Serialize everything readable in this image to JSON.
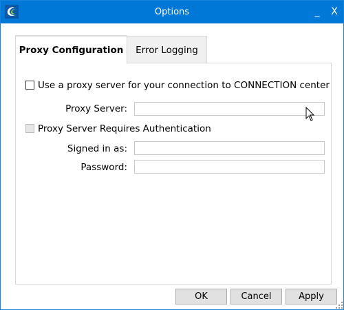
{
  "window": {
    "title": "Options",
    "minimize_glyph": "_",
    "close_glyph": "X"
  },
  "tabs": [
    {
      "label": "Proxy Configuration",
      "active": true
    },
    {
      "label": "Error Logging",
      "active": false
    }
  ],
  "proxy": {
    "use_proxy_label": "Use a proxy server for your connection to CONNECTION center",
    "use_proxy_checked": false,
    "proxy_server_label": "Proxy Server:",
    "proxy_server_value": "",
    "requires_auth_label": "Proxy Server Requires Authentication",
    "requires_auth_checked": false,
    "signed_in_label": "Signed in as:",
    "signed_in_value": "",
    "password_label": "Password:",
    "password_value": ""
  },
  "buttons": {
    "ok": "OK",
    "cancel": "Cancel",
    "apply": "Apply"
  },
  "colors": {
    "titlebar": "#0078d7",
    "button_face": "#e1e1e1"
  },
  "icons": {
    "app": "connection-app-icon",
    "cursor": "mouse-pointer-icon",
    "resize": "resize-grip-icon"
  }
}
